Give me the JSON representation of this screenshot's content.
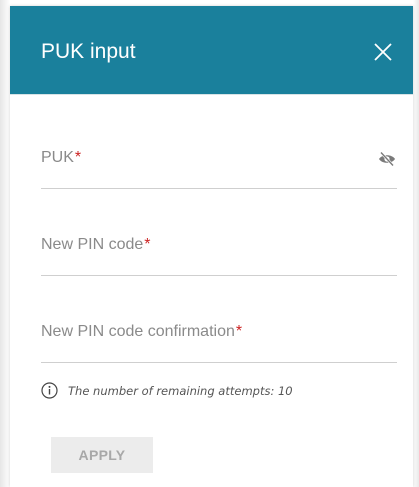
{
  "dialog": {
    "title": "PUK input",
    "close_icon": "close-icon"
  },
  "form": {
    "puk": {
      "label": "PUK",
      "required_mark": "*",
      "visibility_icon": "eye-off-icon"
    },
    "new_pin": {
      "label": "New PIN code",
      "required_mark": "*"
    },
    "new_pin_confirm": {
      "label": "New PIN code confirmation",
      "required_mark": "*"
    }
  },
  "info": {
    "icon": "info-icon",
    "text": "The number of remaining attempts: 10"
  },
  "actions": {
    "apply_label": "APPLY"
  },
  "colors": {
    "header_bg": "#1a809c",
    "required": "#cc2222",
    "button_disabled_bg": "#ececec",
    "button_disabled_text": "#a8a8a8"
  }
}
